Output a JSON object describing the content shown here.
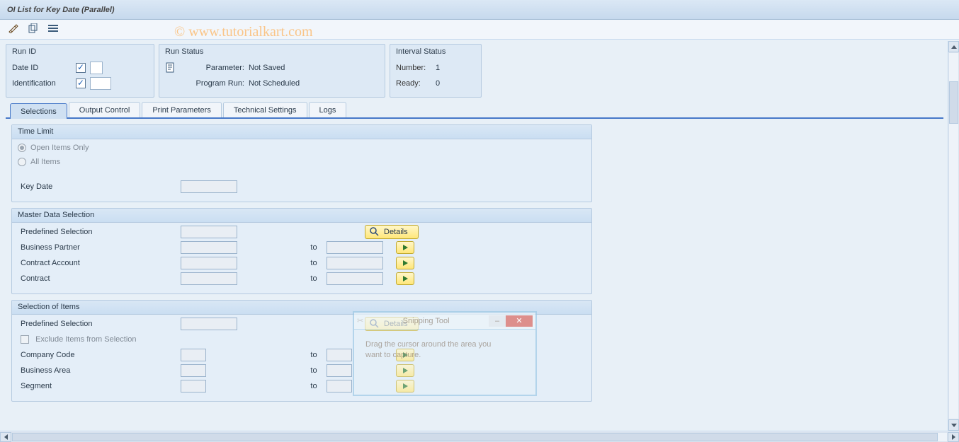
{
  "title": "OI List for Key Date (Parallel)",
  "watermark": "© www.tutorialkart.com",
  "toolbar": {
    "edit_icon": "pencil-double-icon",
    "copy_icon": "copy-icon",
    "layout_icon": "layout-icon"
  },
  "panels": {
    "run_id": {
      "title": "Run ID",
      "date_id_label": "Date ID",
      "identification_label": "Identification"
    },
    "run_status": {
      "title": "Run Status",
      "parameter_label": "Parameter:",
      "parameter_value": "Not Saved",
      "program_run_label": "Program Run:",
      "program_run_value": "Not Scheduled"
    },
    "interval_status": {
      "title": "Interval Status",
      "number_label": "Number:",
      "number_value": "1",
      "ready_label": "Ready:",
      "ready_value": "0"
    }
  },
  "tabs": {
    "selections": "Selections",
    "output_control": "Output Control",
    "print_parameters": "Print Parameters",
    "technical_settings": "Technical Settings",
    "logs": "Logs"
  },
  "time_limit": {
    "title": "Time Limit",
    "open_items_only": "Open Items Only",
    "all_items": "All Items",
    "key_date_label": "Key Date"
  },
  "master_data": {
    "title": "Master Data Selection",
    "predefined_selection": "Predefined Selection",
    "business_partner": "Business Partner",
    "contract_account": "Contract Account",
    "contract": "Contract",
    "to": "to",
    "details": "Details"
  },
  "selection_items": {
    "title": "Selection of Items",
    "predefined_selection": "Predefined Selection",
    "exclude_items": "Exclude Items from Selection",
    "company_code": "Company Code",
    "business_area": "Business Area",
    "segment": "Segment",
    "to": "to",
    "details": "Details"
  },
  "snip": {
    "title": "Snipping Tool",
    "body1": "Drag the cursor around the area you",
    "body2": "want to capture."
  }
}
